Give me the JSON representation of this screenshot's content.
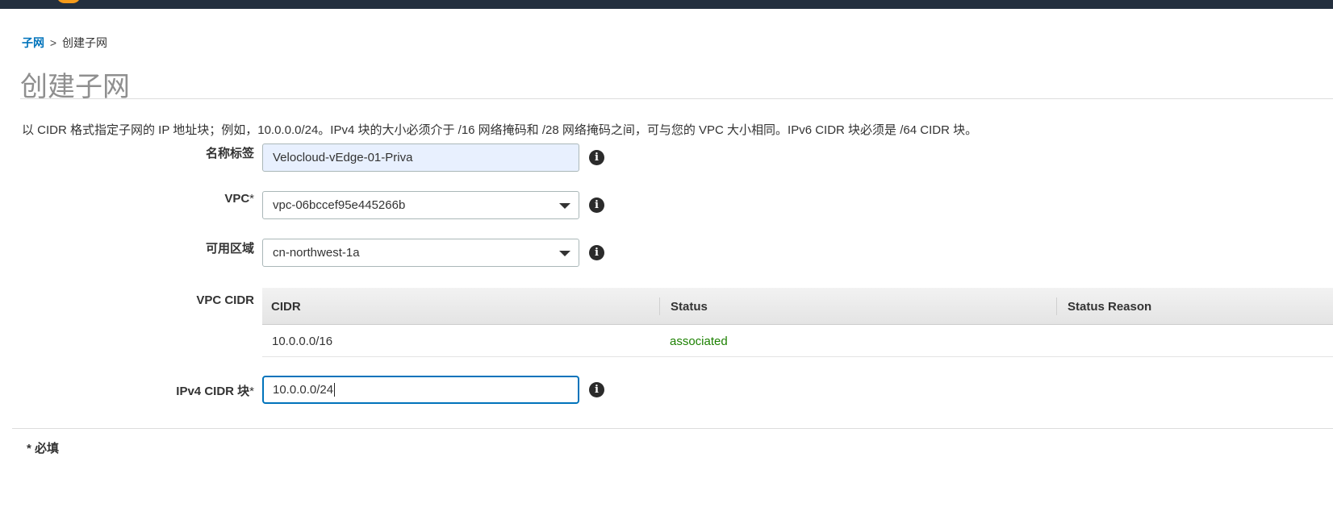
{
  "breadcrumb": {
    "parent": "子网",
    "separator": ">",
    "current": "创建子网"
  },
  "page_title": "创建子网",
  "help_text": "以 CIDR 格式指定子网的 IP 地址块；例如，10.0.0.0/24。IPv4 块的大小必须介于 /16 网络掩码和 /28 网络掩码之间，可与您的 VPC 大小相同。IPv6 CIDR 块必须是 /64 CIDR 块。",
  "form": {
    "name_tag": {
      "label": "名称标签",
      "value": "Velocloud-vEdge-01-Priva"
    },
    "vpc": {
      "label": "VPC",
      "required_mark": "*",
      "value": "vpc-06bccef95e445266b"
    },
    "availability_zone": {
      "label": "可用区域",
      "value": "cn-northwest-1a"
    },
    "vpc_cidr": {
      "label": "VPC CIDR",
      "columns": [
        "CIDR",
        "Status",
        "Status Reason"
      ],
      "rows": [
        {
          "cidr": "10.0.0.0/16",
          "status": "associated",
          "reason": ""
        }
      ]
    },
    "ipv4_cidr": {
      "label": "IPv4 CIDR 块",
      "required_mark": "*",
      "value": "10.0.0.0/24"
    }
  },
  "info_icon_glyph": "i",
  "required_note": "* 必填",
  "colors": {
    "link": "#0073bb",
    "status_ok": "#1d8102",
    "topbar": "#232f3e",
    "focus": "#0073bb",
    "autofill": "#e8f0fe"
  }
}
